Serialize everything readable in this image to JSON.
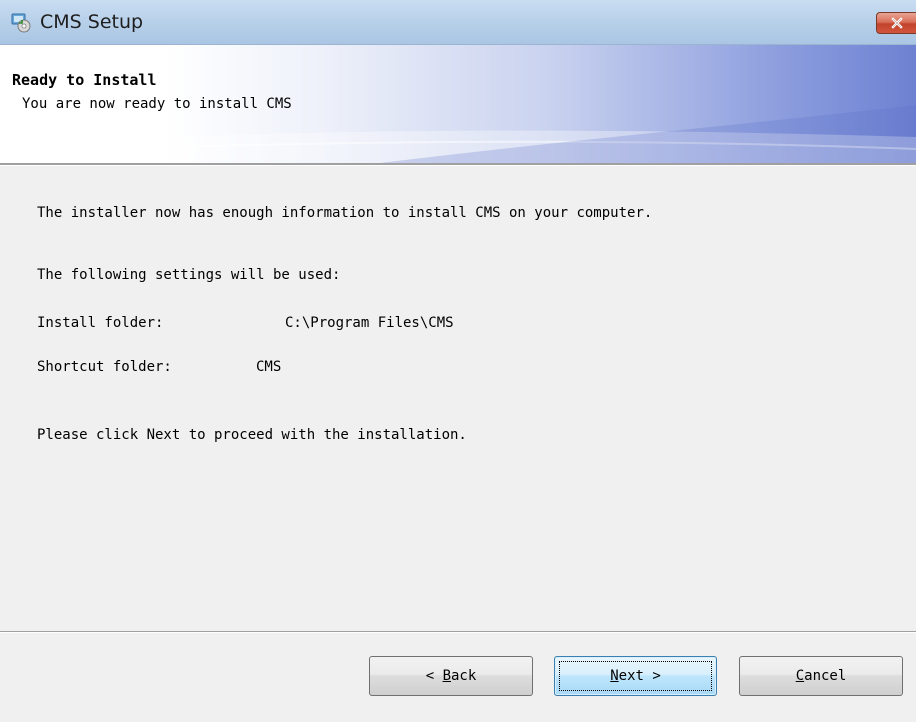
{
  "window": {
    "title": "CMS Setup",
    "icons": {
      "app": "installer-app-icon",
      "close": "close-icon"
    }
  },
  "header": {
    "title": "Ready to Install",
    "subtitle": "You are now ready to install CMS"
  },
  "body": {
    "intro": "The installer now has enough information to install CMS on your computer.",
    "settings_heading": "The following settings will be used:",
    "install_folder": {
      "label": "Install folder:",
      "value": "C:\\Program Files\\CMS"
    },
    "shortcut_folder": {
      "label": "Shortcut folder:",
      "value": "CMS"
    },
    "instruction": "Please click Next to proceed with the installation."
  },
  "buttons": {
    "back": {
      "prefix": "< ",
      "mnemonic": "B",
      "rest": "ack"
    },
    "next": {
      "prefix": "",
      "mnemonic": "N",
      "rest": "ext >"
    },
    "cancel": {
      "prefix": "",
      "mnemonic": "C",
      "rest": "ancel"
    }
  },
  "colors": {
    "titlebar": "#b9d1ea",
    "close_button": "#c2432b",
    "banner_accent": "#6d81d2",
    "default_button_border": "#3c7fb1"
  }
}
